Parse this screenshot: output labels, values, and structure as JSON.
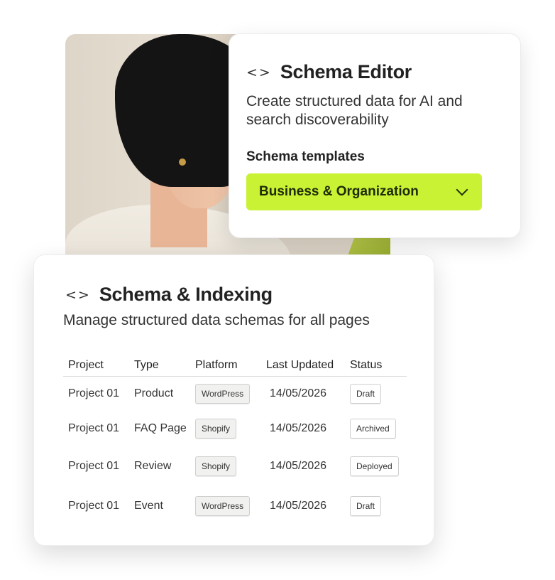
{
  "editor": {
    "code_icon": "<>",
    "title": "Schema Editor",
    "description": "Create structured data for AI and search discoverability",
    "templates_label": "Schema templates",
    "selected_template": "Business & Organization",
    "accent_color": "#c8f233"
  },
  "indexing": {
    "code_icon": "<>",
    "title": "Schema & Indexing",
    "description": "Manage structured data schemas for all pages",
    "columns": [
      "Project",
      "Type",
      "Platform",
      "Last Updated",
      "Status"
    ],
    "rows": [
      {
        "project": "Project 01",
        "type": "Product",
        "platform": "WordPress",
        "updated": "14/05/2026",
        "status": "Draft"
      },
      {
        "project": "Project 01",
        "type": "FAQ Page",
        "platform": "Shopify",
        "updated": "14/05/2026",
        "status": "Archived"
      },
      {
        "project": "Project 01",
        "type": "Review",
        "platform": "Shopify",
        "updated": "14/05/2026",
        "status": "Deployed"
      },
      {
        "project": "Project 01",
        "type": "Event",
        "platform": "WordPress",
        "updated": "14/05/2026",
        "status": "Draft"
      }
    ]
  }
}
